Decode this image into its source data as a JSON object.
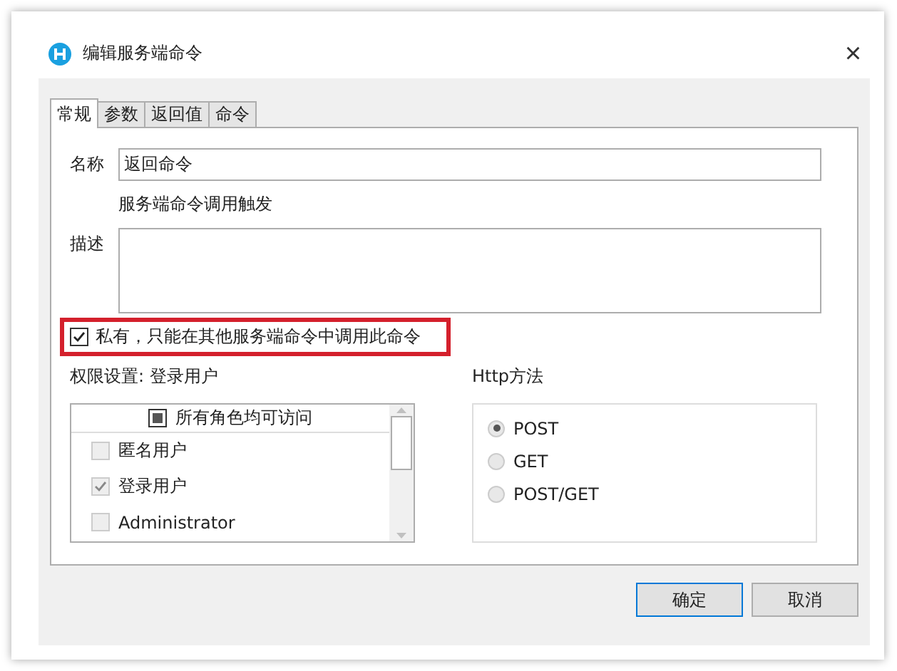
{
  "window": {
    "title": "编辑服务端命令",
    "close": "×"
  },
  "tabs": [
    {
      "label": "常规",
      "selected": true
    },
    {
      "label": "参数",
      "selected": false
    },
    {
      "label": "返回值",
      "selected": false
    },
    {
      "label": "命令",
      "selected": false
    }
  ],
  "name": {
    "label": "名称",
    "value": "返回命令"
  },
  "trigger_text": "服务端命令调用触发",
  "description": {
    "label": "描述"
  },
  "private": {
    "label": "私有，只能在其他服务端命令中调用此命令",
    "checked": true,
    "highlighted": true
  },
  "permissions": {
    "label": "权限设置: 登录用户",
    "header": {
      "label": "所有角色均可访问",
      "indeterminate": true
    },
    "roles": [
      {
        "label": "匿名用户",
        "checked": false
      },
      {
        "label": "登录用户",
        "checked": true
      },
      {
        "label": "Administrator",
        "checked": false
      }
    ]
  },
  "http": {
    "label": "Http方法",
    "options": [
      {
        "label": "POST",
        "selected": true
      },
      {
        "label": "GET",
        "selected": false
      },
      {
        "label": "POST/GET",
        "selected": false
      }
    ]
  },
  "buttons": [
    {
      "label": "确定",
      "primary": true
    },
    {
      "label": "取消",
      "primary": false
    }
  ]
}
